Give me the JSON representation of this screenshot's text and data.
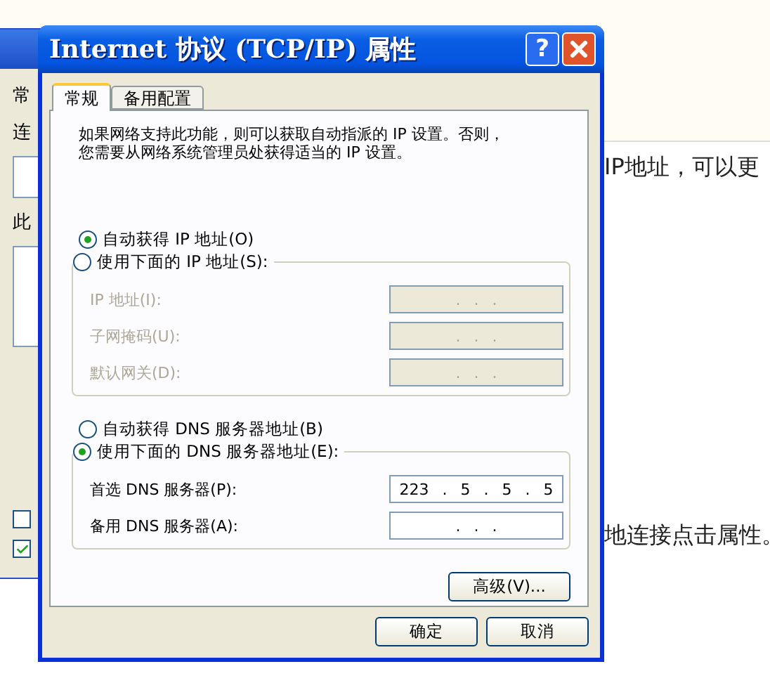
{
  "page": {
    "text_lines": [
      "IP地址，可以更",
      "地连接点击属性。"
    ]
  },
  "back_window": {
    "tab": "常",
    "labels": [
      "连",
      "此"
    ],
    "checkboxes": [
      {
        "checked": false
      },
      {
        "checked": true
      }
    ]
  },
  "dialog": {
    "title": "Internet 协议 (TCP/IP) 属性",
    "help": "?",
    "tabs": [
      {
        "label": "常规",
        "selected": true
      },
      {
        "label": "备用配置",
        "selected": false
      }
    ],
    "description_lines": [
      "如果网络支持此功能，则可以获取自动指派的 IP 设置。否则，",
      "您需要从网络系统管理员处获得适当的 IP 设置。"
    ],
    "ip_mode": [
      {
        "label": "自动获得 IP 地址(O)",
        "selected": true
      },
      {
        "label": "使用下面的 IP 地址(S):",
        "selected": false
      }
    ],
    "ip_fields": [
      {
        "label": "IP 地址(I):",
        "value": ". . .",
        "disabled": true
      },
      {
        "label": "子网掩码(U):",
        "value": ". . .",
        "disabled": true
      },
      {
        "label": "默认网关(D):",
        "value": ". . .",
        "disabled": true
      }
    ],
    "dns_mode": [
      {
        "label": "自动获得 DNS 服务器地址(B)",
        "selected": false
      },
      {
        "label": "使用下面的 DNS 服务器地址(E):",
        "selected": true
      }
    ],
    "dns_fields": [
      {
        "label": "首选 DNS 服务器(P):",
        "value": "223 . 5 . 5 . 5",
        "disabled": false
      },
      {
        "label": "备用 DNS 服务器(A):",
        "value": ". . .",
        "disabled": false
      }
    ],
    "advanced_button": "高级(V)...",
    "buttons": [
      "确定",
      "取消"
    ]
  }
}
